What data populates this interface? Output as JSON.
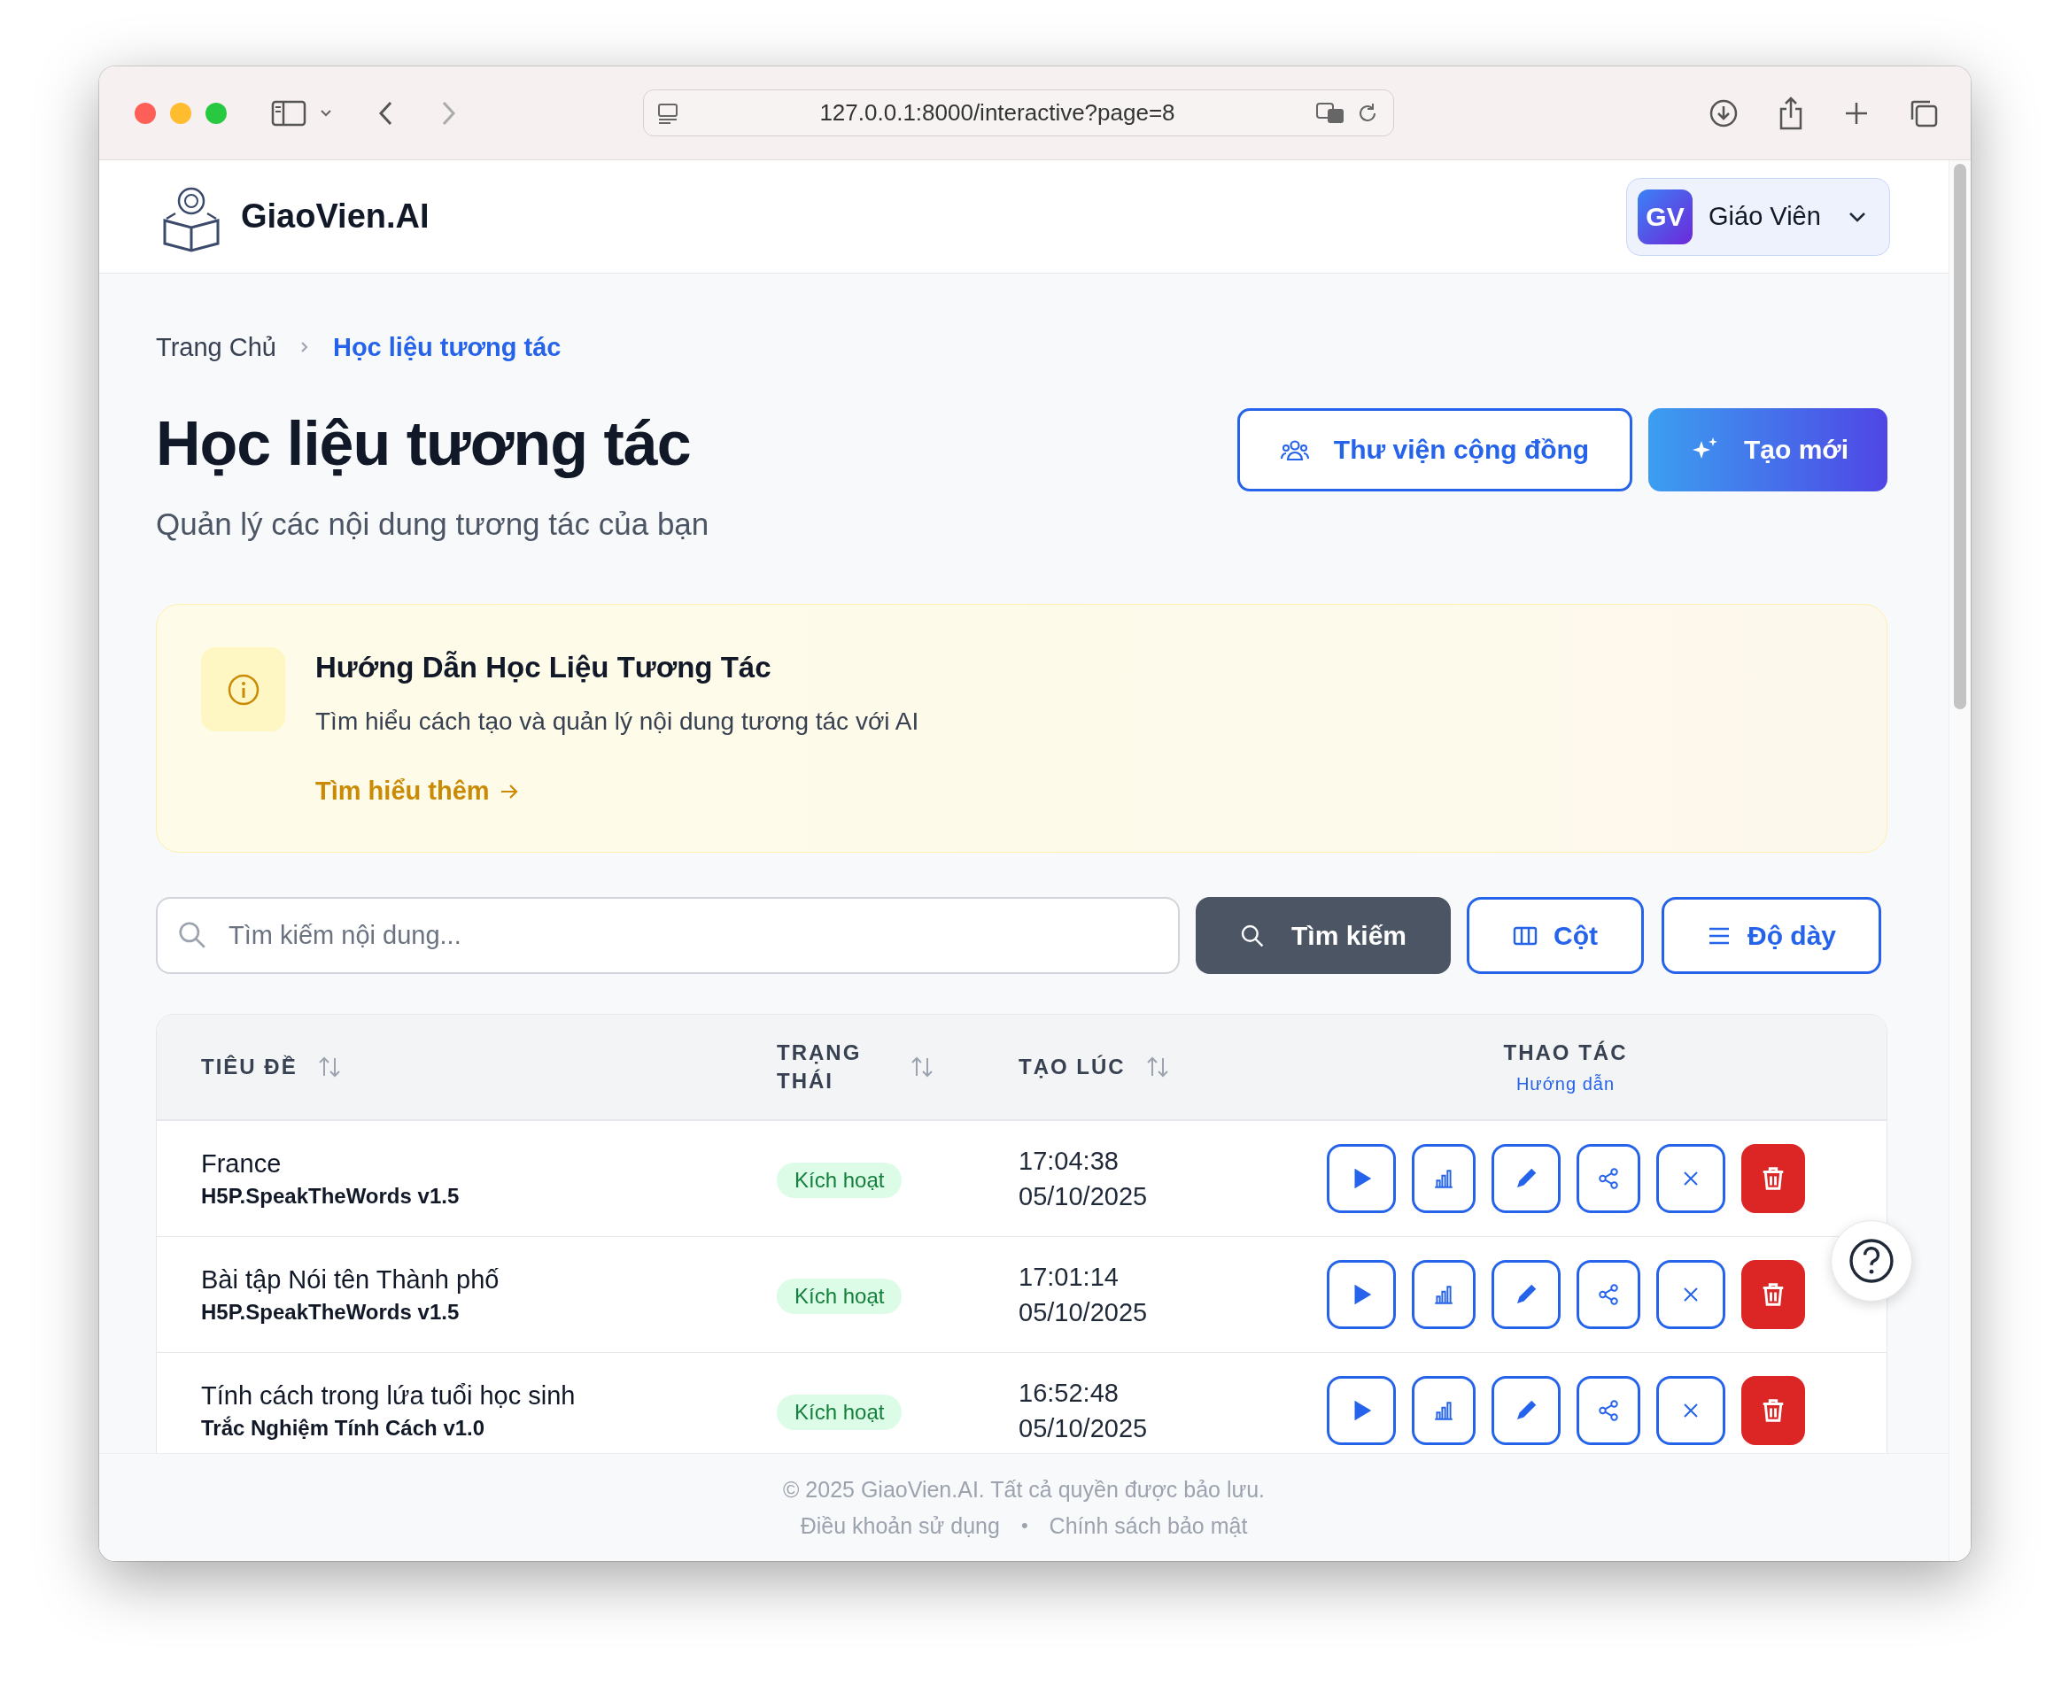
{
  "browser": {
    "url": "127.0.0.1:8000/interactive?page=8"
  },
  "header": {
    "brand": "GiaoVien.AI",
    "user": {
      "initials": "GV",
      "name": "Giáo Viên"
    }
  },
  "breadcrumb": [
    {
      "label": "Trang Chủ",
      "selected": false
    },
    {
      "label": "Học liệu tương tác",
      "selected": true
    }
  ],
  "page": {
    "title": "Học liệu tương tác",
    "subtitle": "Quản lý các nội dung tương tác của bạn"
  },
  "actions": [
    {
      "label": "Thư viện cộng đồng",
      "kind": "outline"
    },
    {
      "label": "Tạo mới",
      "kind": "primary"
    }
  ],
  "notice": {
    "title": "Hướng Dẫn Học Liệu Tương Tác",
    "text": "Tìm hiểu cách tạo và quản lý nội dung tương tác với AI",
    "link": "Tìm hiểu thêm"
  },
  "search": {
    "placeholder": "Tìm kiếm nội dung...",
    "button": "Tìm kiếm"
  },
  "toolbar": [
    {
      "label": "Cột",
      "kind": "columns"
    },
    {
      "label": "Độ dày",
      "kind": "density"
    }
  ],
  "table": {
    "columns": [
      {
        "label": "TIÊU ĐỀ",
        "sortable": true
      },
      {
        "label": "TRẠNG THÁI",
        "sortable": true
      },
      {
        "label": "TẠO LÚC",
        "sortable": true
      },
      {
        "label": "THAO TÁC",
        "hint": "Hướng dẫn"
      }
    ],
    "rows": [
      {
        "title": "France",
        "type": "H5P.SpeakTheWords v1.5",
        "status": "Kích hoạt",
        "time": "17:04:38",
        "date": "05/10/2025"
      },
      {
        "title": "Bài tập Nói tên Thành phố",
        "type": "H5P.SpeakTheWords v1.5",
        "status": "Kích hoạt",
        "time": "17:01:14",
        "date": "05/10/2025"
      },
      {
        "title": "Tính cách trong lứa tuổi học sinh",
        "type": "Trắc Nghiệm Tính Cách v1.0",
        "status": "Kích hoạt",
        "time": "16:52:48",
        "date": "05/10/2025"
      }
    ]
  },
  "footer": {
    "copyright": "© 2025 GiaoVien.AI. Tất cả quyền được bảo lưu.",
    "links": [
      "Điều khoản sử dụng",
      "Chính sách bảo mật"
    ],
    "separator": "•"
  }
}
